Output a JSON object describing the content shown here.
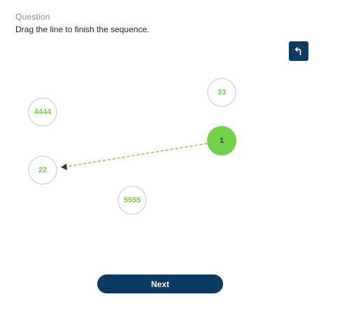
{
  "question": {
    "label": "Question",
    "prompt": "Drag the line to finish the sequence."
  },
  "toolbar": {
    "undo_icon": "undo-arrow-icon"
  },
  "nodes": {
    "n33": {
      "label": "33",
      "state": "idle"
    },
    "n4444": {
      "label": "4444",
      "state": "idle"
    },
    "n1": {
      "label": "1",
      "state": "selected"
    },
    "n22": {
      "label": "22",
      "state": "idle"
    },
    "n5555": {
      "label": "5555",
      "state": "idle"
    }
  },
  "connection": {
    "from": "1",
    "to": "22",
    "style": "dashed"
  },
  "footer": {
    "next_label": "Next"
  },
  "colors": {
    "primary": "#0b3a63",
    "accent_green": "#72d24a",
    "node_border": "#e1e1e1",
    "node_text": "#74cf45"
  }
}
